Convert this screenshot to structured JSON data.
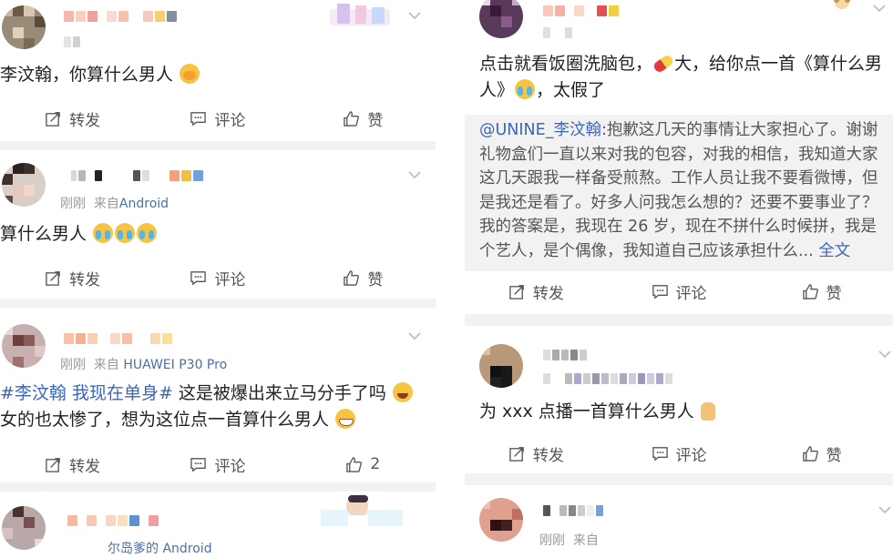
{
  "left_column": {
    "posts": [
      {
        "meta": "",
        "text": "李汶翰，你算什么男人",
        "actions": {
          "repost": "转发",
          "comment": "评论",
          "like": "赞"
        }
      },
      {
        "meta_time": "刚刚",
        "meta_source_prefix": "来自",
        "meta_source": "Android",
        "text": "算什么男人",
        "actions": {
          "repost": "转发",
          "comment": "评论",
          "like": "赞"
        }
      },
      {
        "meta_time": "刚刚",
        "meta_source_prefix": "来自",
        "meta_source": "HUAWEI P30 Pro",
        "topic": "#李汶翰 我现在单身#",
        "text_line1": " 这是被爆出来立马分手了吗",
        "text_line2": "女的也太惨了，想为这位点一首算什么男人",
        "actions": {
          "repost": "转发",
          "comment": "评论",
          "like": "2"
        }
      },
      {
        "meta_source": "尔岛爹的 Android"
      }
    ]
  },
  "right_column": {
    "posts": [
      {
        "text_line1": "点击就看饭圈洗脑包，",
        "text_line1b": "大，给你点一首《算什么男",
        "text_line2": "人》",
        "text_line2b": "，太假了",
        "repost": {
          "at": "@UNINE_李汶翰",
          "lines": [
            ":抱歉这几天的事情让大家担心了。谢谢",
            "礼物盒们一直以来对我的包容，对我的相信，我知道大家",
            "这几天跟我一样备受煎熬。工作人员让我不要看微博，但",
            "是我还是看了。好多人问我怎么想的？还要不要事业了？",
            "我的答案是，我现在 26 岁，现在不拼什么时候拼，我是",
            "个艺人，是个偶像，我知道自己应该承担什么..."
          ],
          "more": "全文"
        },
        "actions": {
          "repost": "转发",
          "comment": "评论",
          "like": "赞"
        }
      },
      {
        "text": "为 xxx 点播一首算什么男人",
        "actions": {
          "repost": "转发",
          "comment": "评论",
          "like": "赞"
        }
      },
      {
        "meta_time": "刚刚",
        "meta_source_prefix": "来自"
      }
    ]
  },
  "colors": {
    "link": "#3b67b8",
    "meta": "#999999",
    "separator": "#f2f2f2"
  }
}
